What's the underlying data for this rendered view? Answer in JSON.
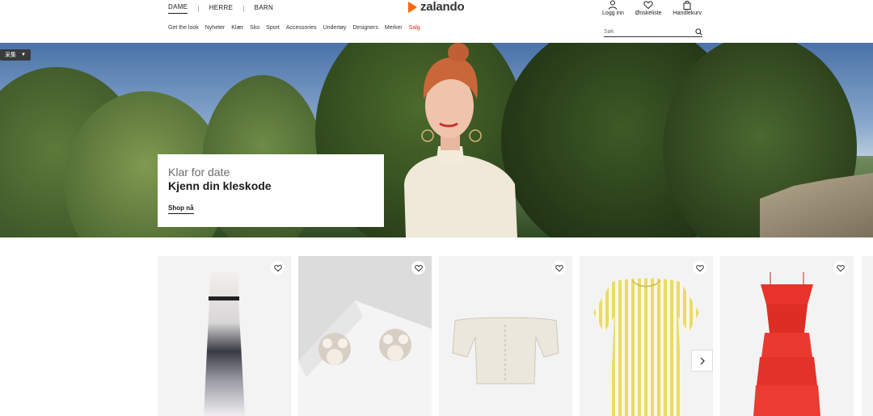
{
  "header": {
    "genders": [
      {
        "label": "DAME",
        "active": true
      },
      {
        "label": "HERRE",
        "active": false
      },
      {
        "label": "BARN",
        "active": false
      }
    ],
    "separator": "|",
    "logo_text": "zalando",
    "categories": [
      "Get the look",
      "Nyheter",
      "Klær",
      "Sko",
      "Sport",
      "Accessories",
      "Undertøy",
      "Designers",
      "Merker",
      "Salg"
    ],
    "user_nav": {
      "login": "Logg inn",
      "wishlist": "Ønskeliste",
      "cart": "Handlekurv"
    },
    "search_placeholder": "Søk"
  },
  "hero": {
    "collect_tag": "采集",
    "subtitle": "Klar for date",
    "title": "Kjenn din kleskode",
    "cta": "Shop nå"
  },
  "colors": {
    "brand_orange": "#ff6900",
    "sale_red": "#e0301e"
  },
  "products": [
    {
      "name": "dress-ombre-icon"
    },
    {
      "name": "earrings-icon"
    },
    {
      "name": "offshoulder-top-icon"
    },
    {
      "name": "yellow-stripe-dress-icon"
    },
    {
      "name": "red-ruffle-dress-icon"
    }
  ]
}
